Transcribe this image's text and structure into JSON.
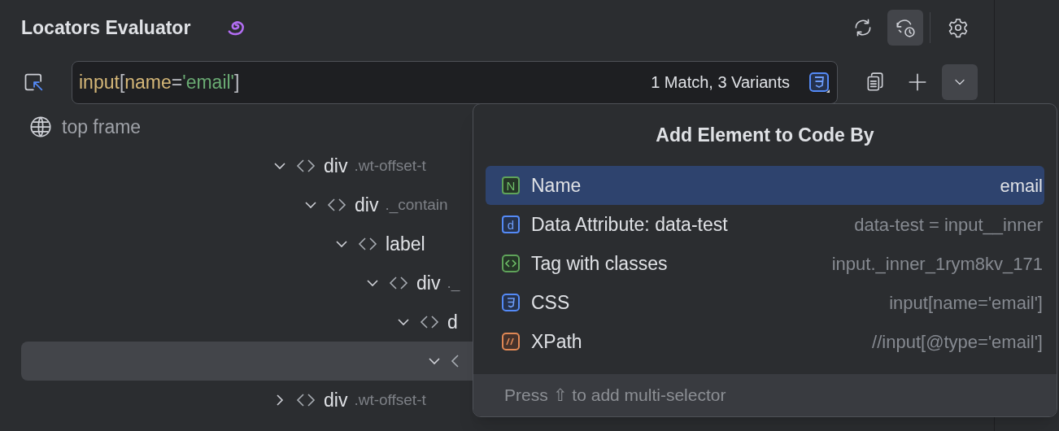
{
  "title": "Locators Evaluator",
  "header_buttons": [
    {
      "kind": "sync",
      "selected": false
    },
    {
      "kind": "history",
      "selected": true
    },
    {
      "kind": "settings",
      "selected": false
    }
  ],
  "locator": {
    "tokens": [
      {
        "text": "input",
        "kind": "tag"
      },
      {
        "text": "[",
        "kind": "punct"
      },
      {
        "text": "name",
        "kind": "attr"
      },
      {
        "text": "=",
        "kind": "punct"
      },
      {
        "text": "'email'",
        "kind": "string"
      },
      {
        "text": "]",
        "kind": "punct"
      }
    ],
    "status": "1 Match, 3 Variants"
  },
  "locator_buttons": [
    {
      "kind": "copy",
      "selected": false
    },
    {
      "kind": "add",
      "selected": false
    },
    {
      "kind": "dropdown",
      "selected": true
    }
  ],
  "frame": "top frame",
  "tree": [
    {
      "tag": "div",
      "cls": ".wt-offset-t",
      "expanded": true,
      "selected": false,
      "children": [
        {
          "tag": "div",
          "cls": "._contain",
          "expanded": true,
          "selected": false,
          "children": [
            {
              "tag": "label",
              "expanded": true,
              "selected": false,
              "children": [
                {
                  "tag": "div",
                  "cls": "._",
                  "expanded": true,
                  "selected": false,
                  "children": [
                    {
                      "tag": "d",
                      "expanded": true,
                      "selected": false,
                      "children": [
                        {
                          "expanded": true,
                          "selected": true
                        }
                      ]
                    }
                  ]
                }
              ]
            }
          ]
        }
      ]
    },
    {
      "tag": "div",
      "cls": ".wt-offset-t",
      "expanded": false,
      "selected": false
    }
  ],
  "popup": {
    "title": "Add Element to Code By",
    "items": [
      {
        "kind": "name",
        "badge": "N",
        "label": "Name",
        "value": "email",
        "selected": true
      },
      {
        "kind": "data",
        "badge": "d",
        "label": "Data Attribute: data-test",
        "value": "data-test = input__inner",
        "selected": false
      },
      {
        "kind": "tag",
        "label": "Tag with classes",
        "value": "input._inner_1rym8kv_171",
        "selected": false
      },
      {
        "kind": "css",
        "label": "CSS",
        "value": "input[name='email']",
        "selected": false
      },
      {
        "kind": "xpath",
        "label": "XPath",
        "value": "//input[@type='email']",
        "selected": false
      }
    ],
    "footer": "Press ⇧ to add multi-selector"
  }
}
